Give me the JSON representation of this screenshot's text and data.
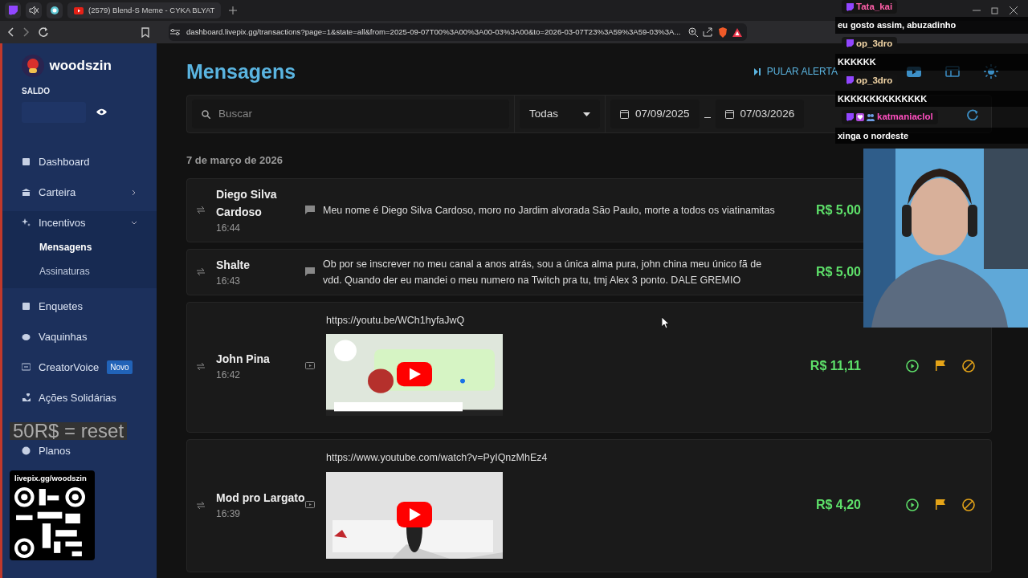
{
  "browser": {
    "tabs": [
      {
        "title": "(2579) Blend-S Meme - CYKA BLYAT",
        "selected": true
      }
    ],
    "url": "dashboard.livepix.gg/transactions?page=1&state=all&from=2025-09-07T00%3A00%3A00-03%3A00&to=2026-03-07T23%3A59%3A59-03%3A..."
  },
  "sidebar": {
    "user": "woodszin",
    "balance_label": "SALDO",
    "items": [
      {
        "label": "Dashboard",
        "selected": false,
        "expandable": false
      },
      {
        "label": "Carteira",
        "selected": false,
        "expandable": true,
        "expanded": false
      },
      {
        "label": "Incentivos",
        "selected": false,
        "expandable": true,
        "expanded": true,
        "children": [
          {
            "label": "Mensagens",
            "selected": true
          },
          {
            "label": "Assinaturas",
            "selected": false
          }
        ]
      },
      {
        "label": "Enquetes",
        "selected": false,
        "expandable": false
      },
      {
        "label": "Vaquinhas",
        "selected": false,
        "expandable": false
      },
      {
        "label": "CreatorVoice",
        "selected": false,
        "expandable": false,
        "badge": "Novo"
      },
      {
        "label": "Ações Solidárias",
        "selected": false,
        "expandable": false
      },
      {
        "label": "Planos",
        "selected": false,
        "expandable": false
      }
    ]
  },
  "page": {
    "title": "Mensagens",
    "skip_alert": "PULAR ALERTA",
    "search": {
      "placeholder": "Buscar"
    },
    "filter": "Todas",
    "date_from": "07/09/2025",
    "date_to": "07/03/2026",
    "date_heading": "7 de março de 2026",
    "messages": [
      {
        "kind": "text",
        "name": "Diego Silva Cardoso",
        "time": "16:44",
        "text": "Meu nome é Diego Silva Cardoso, moro no Jardim alvorada São Paulo, morte a todos os viatinamitas",
        "amount": "R$ 5,00"
      },
      {
        "kind": "text",
        "name": "Shalte",
        "time": "16:43",
        "text": "Ob por se inscrever no meu canal a anos atrás, sou a única alma pura, john china meu único fã de vdd. Quando der eu mandei o meu numero na Twitch pra tu, tmj Alex 3 ponto. DALE GREMIO",
        "amount": "R$ 5,00"
      },
      {
        "kind": "video",
        "name": "John Pina",
        "time": "16:42",
        "url": "https://youtu.be/WCh1hyfaJwQ",
        "amount": "R$ 11,11"
      },
      {
        "kind": "video",
        "name": "Mod pro Largato",
        "time": "16:39",
        "url": "https://www.youtube.com/watch?v=PyIQnzMhEz4",
        "amount": "R$ 4,20"
      }
    ]
  },
  "overlay": {
    "chat": [
      {
        "user": "Tata_kai",
        "color": "#ff5fa8",
        "extra_badges": false,
        "text": "eu gosto assim, abuzadinho"
      },
      {
        "user": "op_3dro",
        "color": "#f3d6a6",
        "extra_badges": false,
        "text": "KKKKKK"
      },
      {
        "user": "op_3dro",
        "color": "#f3d6a6",
        "extra_badges": false,
        "text": "KKKKKKKKKKKKKK"
      },
      {
        "user": "katmaniaclol",
        "color": "#ff4fc0",
        "extra_badges": true,
        "text": "xinga o nordeste"
      }
    ],
    "banner": "50R$ = reset",
    "qr_caption": "livepix.gg/woodszin"
  }
}
